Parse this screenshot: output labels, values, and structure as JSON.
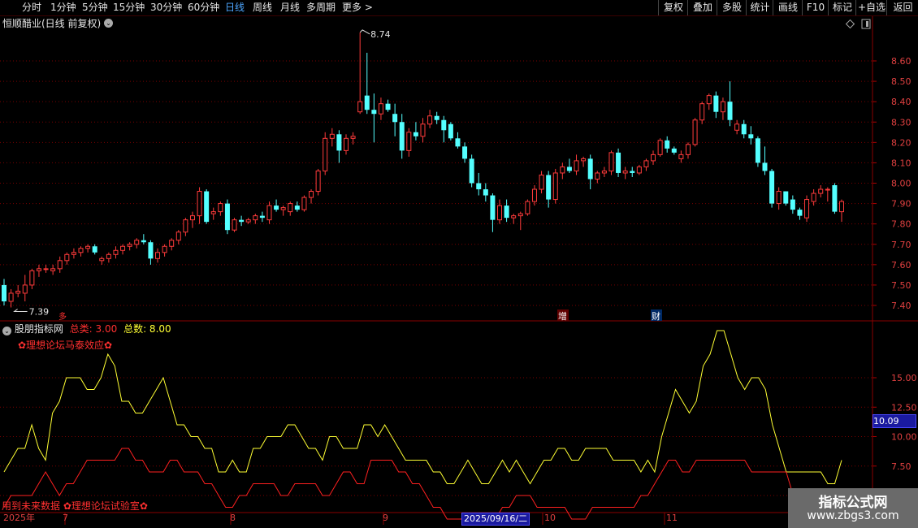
{
  "toolbar": {
    "periods": [
      "分时",
      "1分钟",
      "5分钟",
      "15分钟",
      "30分钟",
      "60分钟",
      "日线",
      "周线",
      "月线",
      "多周期",
      "更多 >"
    ],
    "active_period": "日线",
    "right_buttons": [
      "复权",
      "叠加",
      "多股",
      "统计",
      "画线",
      "F10",
      "标记",
      "+自选",
      "返回"
    ]
  },
  "main_chart": {
    "stock_title": "恒顺醋业(日线 前复权)",
    "high_marker": "8.74",
    "low_marker": "7.39",
    "event_marks": [
      "增",
      "财"
    ],
    "event_mark_left": "多",
    "price_ticks": [
      "8.60",
      "8.50",
      "8.40",
      "8.30",
      "8.20",
      "8.10",
      "8.00",
      "7.90",
      "7.80",
      "7.70",
      "7.60",
      "7.50",
      "7.40"
    ],
    "colors": {
      "up": "#ff3b3b",
      "down": "#54ffff",
      "grid": "#7a0000"
    }
  },
  "sub_chart": {
    "indicator_name": "股朋指标网",
    "label_total_class": "总类: 3.00",
    "label_total_count": "总数: 8.00",
    "caption": "✿理想论坛马泰效应✿",
    "bottom_caption": "用到未来数据 ✿理想论坛试验室✿",
    "value_ticks": [
      "15.00",
      "12.50",
      "10.00",
      "7.50",
      "5.00"
    ],
    "current_value": "10.09",
    "series": [
      {
        "name": "总数",
        "color": "#ffff33"
      },
      {
        "name": "总类",
        "color": "#ff2020"
      }
    ]
  },
  "date_axis": {
    "year_label": "2025年",
    "month_labels": [
      "7",
      "8",
      "9",
      "10",
      "11"
    ],
    "cursor_date": "2025/09/16/二"
  },
  "watermark": {
    "line1": "指标公式网",
    "line2": "www.zbgs3.com"
  },
  "chart_data": [
    {
      "type": "candlestick",
      "title": "恒顺醋业(日线 前复权)",
      "ylim": [
        7.35,
        8.75
      ],
      "ohlc": [
        [
          7.5,
          7.53,
          7.4,
          7.42
        ],
        [
          7.42,
          7.48,
          7.39,
          7.46
        ],
        [
          7.46,
          7.5,
          7.44,
          7.47
        ],
        [
          7.46,
          7.55,
          7.42,
          7.5
        ],
        [
          7.5,
          7.58,
          7.48,
          7.57
        ],
        [
          7.57,
          7.6,
          7.54,
          7.58
        ],
        [
          7.58,
          7.6,
          7.56,
          7.58
        ],
        [
          7.57,
          7.6,
          7.55,
          7.58
        ],
        [
          7.58,
          7.64,
          7.56,
          7.62
        ],
        [
          7.62,
          7.66,
          7.6,
          7.65
        ],
        [
          7.65,
          7.68,
          7.63,
          7.66
        ],
        [
          7.66,
          7.69,
          7.64,
          7.68
        ],
        [
          7.68,
          7.7,
          7.66,
          7.69
        ],
        [
          7.69,
          7.7,
          7.65,
          7.66
        ],
        [
          7.62,
          7.64,
          7.6,
          7.63
        ],
        [
          7.63,
          7.66,
          7.61,
          7.65
        ],
        [
          7.65,
          7.69,
          7.63,
          7.67
        ],
        [
          7.67,
          7.7,
          7.65,
          7.69
        ],
        [
          7.69,
          7.71,
          7.67,
          7.7
        ],
        [
          7.7,
          7.73,
          7.68,
          7.72
        ],
        [
          7.72,
          7.75,
          7.7,
          7.71
        ],
        [
          7.71,
          7.72,
          7.6,
          7.63
        ],
        [
          7.63,
          7.68,
          7.61,
          7.66
        ],
        [
          7.66,
          7.7,
          7.64,
          7.69
        ],
        [
          7.69,
          7.73,
          7.67,
          7.72
        ],
        [
          7.72,
          7.77,
          7.7,
          7.76
        ],
        [
          7.76,
          7.83,
          7.74,
          7.82
        ],
        [
          7.82,
          7.86,
          7.78,
          7.84
        ],
        [
          7.84,
          7.98,
          7.8,
          7.96
        ],
        [
          7.96,
          7.97,
          7.8,
          7.81
        ],
        [
          7.85,
          7.88,
          7.82,
          7.86
        ],
        [
          7.86,
          7.91,
          7.84,
          7.9
        ],
        [
          7.9,
          7.92,
          7.75,
          7.77
        ],
        [
          7.77,
          7.83,
          7.76,
          7.82
        ],
        [
          7.82,
          7.84,
          7.79,
          7.81
        ],
        [
          7.81,
          7.83,
          7.8,
          7.82
        ],
        [
          7.82,
          7.85,
          7.8,
          7.84
        ],
        [
          7.84,
          7.86,
          7.81,
          7.83
        ],
        [
          7.82,
          7.91,
          7.8,
          7.89
        ],
        [
          7.89,
          7.92,
          7.86,
          7.87
        ],
        [
          7.87,
          7.89,
          7.84,
          7.88
        ],
        [
          7.86,
          7.91,
          7.84,
          7.9
        ],
        [
          7.89,
          7.91,
          7.86,
          7.87
        ],
        [
          7.87,
          7.94,
          7.86,
          7.93
        ],
        [
          7.93,
          7.97,
          7.9,
          7.96
        ],
        [
          7.96,
          8.07,
          7.94,
          8.06
        ],
        [
          8.06,
          8.25,
          8.04,
          8.22
        ],
        [
          8.22,
          8.27,
          8.18,
          8.24
        ],
        [
          8.24,
          8.26,
          8.1,
          8.16
        ],
        [
          8.16,
          8.24,
          8.14,
          8.22
        ],
        [
          8.22,
          8.25,
          8.19,
          8.23
        ],
        [
          8.35,
          8.74,
          8.34,
          8.4
        ],
        [
          8.43,
          8.64,
          8.34,
          8.36
        ],
        [
          8.36,
          8.44,
          8.2,
          8.34
        ],
        [
          8.34,
          8.42,
          8.31,
          8.39
        ],
        [
          8.39,
          8.41,
          8.35,
          8.36
        ],
        [
          8.34,
          8.39,
          8.23,
          8.3
        ],
        [
          8.3,
          8.34,
          8.12,
          8.16
        ],
        [
          8.16,
          8.27,
          8.13,
          8.25
        ],
        [
          8.25,
          8.3,
          8.21,
          8.23
        ],
        [
          8.23,
          8.32,
          8.2,
          8.29
        ],
        [
          8.29,
          8.36,
          8.27,
          8.33
        ],
        [
          8.33,
          8.35,
          8.29,
          8.31
        ],
        [
          8.31,
          8.33,
          8.2,
          8.26
        ],
        [
          8.29,
          8.3,
          8.21,
          8.22
        ],
        [
          8.22,
          8.25,
          8.17,
          8.18
        ],
        [
          8.18,
          8.2,
          8.1,
          8.12
        ],
        [
          8.12,
          8.14,
          7.98,
          8.0
        ],
        [
          8.0,
          8.05,
          7.94,
          7.97
        ],
        [
          7.97,
          8.0,
          7.91,
          7.94
        ],
        [
          7.94,
          7.95,
          7.76,
          7.82
        ],
        [
          7.82,
          7.92,
          7.8,
          7.89
        ],
        [
          7.89,
          7.92,
          7.81,
          7.83
        ],
        [
          7.83,
          7.85,
          7.8,
          7.84
        ],
        [
          7.84,
          7.86,
          7.77,
          7.85
        ],
        [
          7.85,
          7.92,
          7.84,
          7.91
        ],
        [
          7.91,
          7.99,
          7.89,
          7.97
        ],
        [
          7.97,
          8.06,
          7.95,
          8.04
        ],
        [
          8.04,
          8.06,
          7.88,
          7.92
        ],
        [
          7.92,
          8.07,
          7.9,
          8.05
        ],
        [
          8.05,
          8.1,
          8.02,
          8.08
        ],
        [
          8.08,
          8.12,
          8.05,
          8.06
        ],
        [
          8.06,
          8.14,
          8.04,
          8.11
        ],
        [
          8.11,
          8.13,
          8.08,
          8.12
        ],
        [
          8.12,
          8.14,
          7.97,
          8.02
        ],
        [
          8.02,
          8.06,
          8.0,
          8.05
        ],
        [
          8.05,
          8.08,
          8.03,
          8.06
        ],
        [
          8.06,
          8.16,
          8.04,
          8.15
        ],
        [
          8.15,
          8.17,
          8.03,
          8.05
        ],
        [
          8.05,
          8.08,
          8.02,
          8.06
        ],
        [
          8.06,
          8.08,
          8.03,
          8.05
        ],
        [
          8.05,
          8.09,
          8.04,
          8.08
        ],
        [
          8.08,
          8.12,
          8.06,
          8.11
        ],
        [
          8.11,
          8.16,
          8.09,
          8.14
        ],
        [
          8.14,
          8.22,
          8.13,
          8.21
        ],
        [
          8.21,
          8.23,
          8.15,
          8.17
        ],
        [
          8.17,
          8.18,
          8.14,
          8.15
        ],
        [
          8.12,
          8.16,
          8.1,
          8.14
        ],
        [
          8.14,
          8.2,
          8.12,
          8.19
        ],
        [
          8.19,
          8.32,
          8.18,
          8.31
        ],
        [
          8.31,
          8.4,
          8.29,
          8.39
        ],
        [
          8.39,
          8.44,
          8.36,
          8.43
        ],
        [
          8.43,
          8.45,
          8.32,
          8.35
        ],
        [
          8.35,
          8.42,
          8.31,
          8.4
        ],
        [
          8.4,
          8.5,
          8.28,
          8.31
        ],
        [
          8.26,
          8.31,
          8.24,
          8.29
        ],
        [
          8.29,
          8.31,
          8.22,
          8.24
        ],
        [
          8.24,
          8.28,
          8.19,
          8.22
        ],
        [
          8.22,
          8.23,
          8.08,
          8.1
        ],
        [
          8.1,
          8.18,
          8.04,
          8.06
        ],
        [
          8.06,
          8.07,
          7.88,
          7.9
        ],
        [
          7.9,
          7.98,
          7.87,
          7.96
        ],
        [
          7.96,
          7.96,
          7.89,
          7.9
        ],
        [
          7.92,
          7.94,
          7.85,
          7.87
        ],
        [
          7.87,
          7.88,
          7.82,
          7.84
        ],
        [
          7.83,
          7.94,
          7.81,
          7.92
        ],
        [
          7.91,
          7.97,
          7.89,
          7.95
        ],
        [
          7.95,
          7.99,
          7.93,
          7.97
        ],
        [
          7.97,
          7.98,
          7.91,
          7.97
        ],
        [
          7.99,
          8.0,
          7.85,
          7.86
        ],
        [
          7.86,
          7.92,
          7.81,
          7.91
        ]
      ]
    },
    {
      "type": "line",
      "title": "股朋指标网",
      "ylim": [
        4.5,
        18.5
      ],
      "series": [
        {
          "name": "总数",
          "values": [
            7,
            8,
            9,
            9,
            11,
            9,
            8,
            12,
            13,
            15,
            15,
            15,
            14,
            14,
            15,
            17,
            16,
            13,
            13,
            12,
            12,
            13,
            14,
            15,
            13,
            11,
            11,
            10,
            10,
            9,
            9,
            7,
            7,
            8,
            7,
            7,
            9,
            9,
            10,
            10,
            10,
            11,
            11,
            10,
            9,
            9,
            8,
            10,
            10,
            9,
            9,
            9,
            11,
            11,
            10,
            11,
            10,
            9,
            8,
            8,
            8,
            8,
            7,
            7,
            6,
            6,
            7,
            8,
            7,
            6,
            6,
            7,
            8,
            7,
            8,
            7,
            6,
            7,
            8,
            8,
            9,
            9,
            8,
            8,
            9,
            9,
            9,
            9,
            8,
            8,
            8,
            8,
            7,
            8,
            7,
            10,
            12,
            14,
            13,
            12,
            13,
            16,
            17,
            19,
            19,
            17,
            15,
            14,
            15,
            15,
            14,
            11,
            9,
            7,
            7,
            7,
            7,
            7,
            7,
            6,
            6,
            8
          ]
        },
        {
          "name": "总类",
          "values": [
            4,
            5,
            5,
            5,
            5,
            6,
            7,
            6,
            5,
            6,
            6,
            7,
            8,
            8,
            8,
            8,
            8,
            9,
            9,
            8,
            8,
            7,
            7,
            7,
            8,
            8,
            7,
            7,
            7,
            6,
            6,
            5,
            4,
            4,
            5,
            5,
            6,
            6,
            6,
            6,
            5,
            5,
            6,
            6,
            6,
            6,
            5,
            5,
            6,
            7,
            7,
            6,
            6,
            8,
            8,
            8,
            8,
            7,
            7,
            6,
            6,
            5,
            4,
            4,
            3,
            3,
            3,
            3,
            3,
            3,
            3,
            3,
            4,
            4,
            5,
            5,
            5,
            4,
            4,
            4,
            4,
            4,
            3,
            3,
            3,
            4,
            4,
            4,
            4,
            4,
            4,
            4,
            5,
            5,
            6,
            7,
            8,
            8,
            7,
            7,
            8,
            8,
            8,
            8,
            8,
            8,
            8,
            8,
            7,
            7,
            7,
            7,
            7,
            7,
            5,
            5,
            5,
            5,
            5,
            5,
            4,
            4
          ]
        }
      ]
    }
  ]
}
